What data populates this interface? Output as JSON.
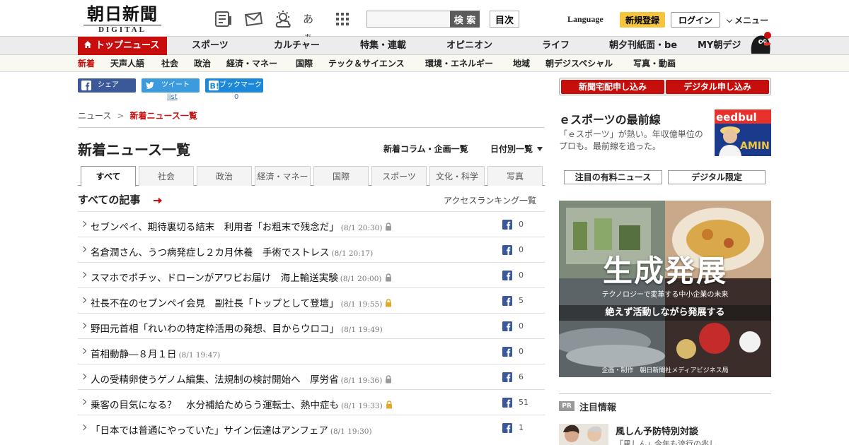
{
  "header": {
    "logo_main": "朝日新聞",
    "logo_sub": "DIGITAL",
    "icons": [
      "newspaper-icon",
      "mail-icon",
      "weather-icon",
      "font-size-icon",
      "grid-menu-icon"
    ],
    "font_size_label": "あぁ",
    "search_placeholder": "",
    "search_button": "検 索",
    "toc_button": "目次",
    "language": "Language",
    "signup": "新規登録",
    "login": "ログイン",
    "menu": "メニュー"
  },
  "nav_primary": [
    "トップニュース",
    "スポーツ",
    "カルチャー",
    "特集・連載",
    "オピニオン",
    "ライフ",
    "朝夕刊紙面・be",
    "MY朝デジ"
  ],
  "nav_secondary": [
    "新着",
    "天声人語",
    "社会",
    "政治",
    "経済・マネー",
    "国際",
    "テック＆サイエンス",
    "環境・エネルギー",
    "地域",
    "朝デジスペシャル",
    "写真・動画"
  ],
  "share": {
    "facebook": "シェア",
    "twitter": "ツイート",
    "twitter_count": "list",
    "hatena": "ブックマーク",
    "hatena_count": "0"
  },
  "breadcrumb": {
    "home": "ニュース",
    "separator": ">",
    "current": "新着ニュース一覧"
  },
  "page": {
    "title": "新着ニュース一覧",
    "link_columns": "新着コラム・企画一覧",
    "link_date": "日付別一覧"
  },
  "tabs": [
    "すべて",
    "社会",
    "政治",
    "経済・マネー",
    "国際",
    "スポーツ",
    "文化・科学",
    "写真"
  ],
  "section": {
    "title": "すべての記事",
    "ranking": "アクセスランキング一覧"
  },
  "news": [
    {
      "title": "セブンペイ、期待裏切る結末　利用者「お粗末で残念だ」",
      "time": "(8/1 20:30)",
      "lock": "gray",
      "fb": "0"
    },
    {
      "title": "名倉潤さん、うつ病発症し２カ月休養　手術でストレス",
      "time": "(8/1 20:17)",
      "lock": "none",
      "fb": "0"
    },
    {
      "title": "スマホでポチッ、ドローンがアワビお届け　海上輸送実験",
      "time": "(8/1 20:00)",
      "lock": "gray",
      "fb": "0"
    },
    {
      "title": "社長不在のセブンペイ会見　副社長「トップとして登壇」",
      "time": "(8/1 19:55)",
      "lock": "gold",
      "fb": "5"
    },
    {
      "title": "野田元首相「れいわの特定枠活用の発想、目からウロコ」",
      "time": "(8/1 19:49)",
      "lock": "none",
      "fb": "0"
    },
    {
      "title": "首相動静―８月１日",
      "time": "(8/1 19:47)",
      "lock": "none",
      "fb": "0"
    },
    {
      "title": "人の受精卵使うゲノム編集、法規制の検討開始へ　厚労省",
      "time": "(8/1 19:36)",
      "lock": "gray",
      "fb": "6"
    },
    {
      "title": "乗客の目気になる？　水分補給ためらう運転士、熱中症も",
      "time": "(8/1 19:33)",
      "lock": "gold",
      "fb": "51"
    },
    {
      "title": "「日本では普通にやっていた」サイン伝達はアンフェア",
      "time": "(8/1 19:30)",
      "lock": "none",
      "fb": "1"
    }
  ],
  "sidebar": {
    "apply_paper": "新聞宅配申し込み",
    "apply_digital": "デジタル申し込み",
    "promo_title": "ｅスポーツの最前線",
    "promo_desc": "「ｅスポーツ」が熱い。年収億単位のプロも。最前線を追った。",
    "tab_paid": "注目の有料ニュース",
    "tab_digital": "デジタル限定",
    "ad_title": "生成発展",
    "ad_sub": "テクノロジーで変革する中小企業の未来",
    "ad_band": "絶えず活動しながら発展する",
    "ad_credit": "企画・制作　朝日新聞社メディアビジネス局",
    "pr_badge": "PR",
    "pr_label": "注目情報",
    "pr_title": "風しん予防特別対談",
    "pr_desc": "「風しん」今年も流行の兆し"
  },
  "colors": {
    "brand_red": "#c80d0d",
    "signup_yellow": "#f5c53e",
    "facebook": "#3b5998",
    "twitter": "#3b9bdc",
    "hatena": "#1e88d8"
  }
}
